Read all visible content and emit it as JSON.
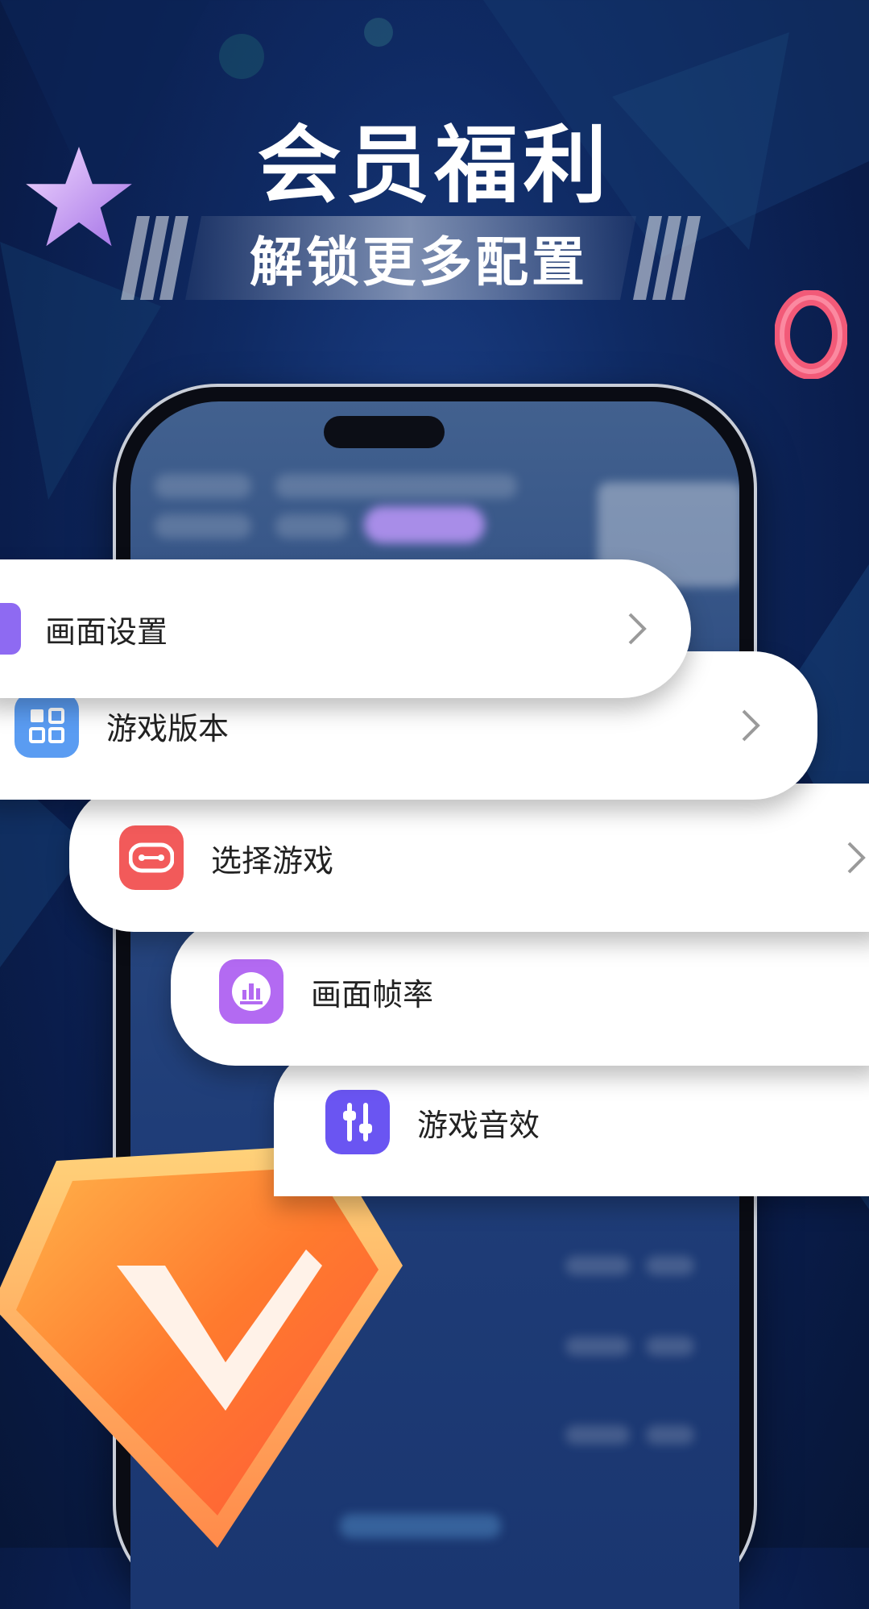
{
  "headline": "会员福利",
  "banner": {
    "text": "解锁更多配置"
  },
  "menu": [
    {
      "label": "画面设置",
      "icon": "purple-tab-icon",
      "has_chevron": true
    },
    {
      "label": "游戏版本",
      "icon": "grid-icon",
      "has_chevron": true
    },
    {
      "label": "选择游戏",
      "icon": "gamepad-icon",
      "has_chevron": true
    },
    {
      "label": "画面帧率",
      "icon": "bar-chart-icon",
      "has_chevron": false
    },
    {
      "label": "游戏音效",
      "icon": "equalizer-icon",
      "has_chevron": false
    }
  ],
  "colors": {
    "background": "#0f2a63",
    "card": "#ffffff",
    "grid_icon": "#5a9cf2",
    "gamepad_icon": "#f25a5a",
    "bar_chart_icon": "#b36af2",
    "equalizer_icon": "#6a55f2",
    "gem": "#ff7a2e"
  }
}
